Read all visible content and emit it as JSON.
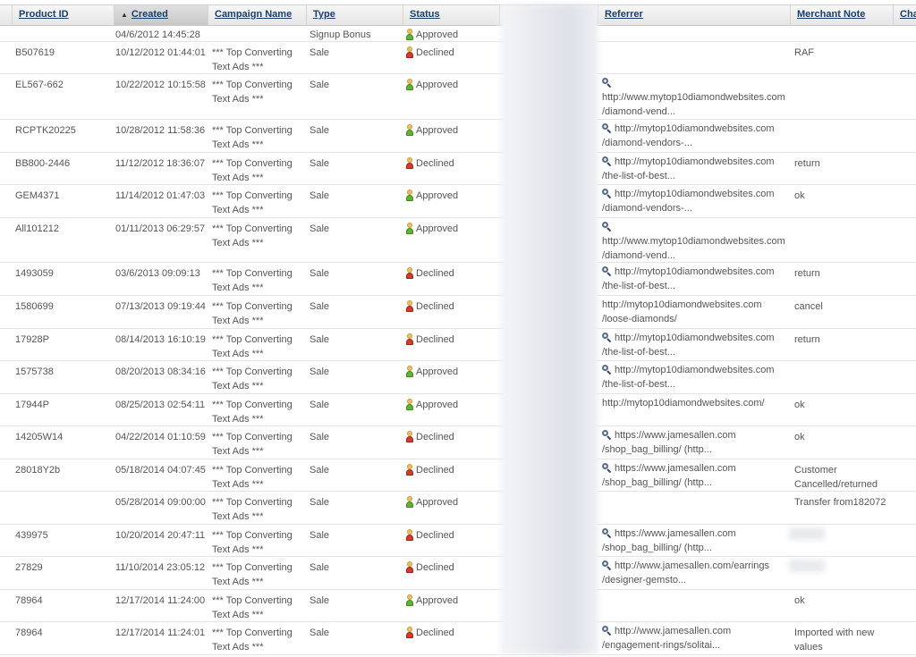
{
  "columns": [
    {
      "key": "product_id",
      "label": "Product ID"
    },
    {
      "key": "created",
      "label": "Created",
      "sorted": true
    },
    {
      "key": "campaign",
      "label": "Campaign Name"
    },
    {
      "key": "type",
      "label": "Type"
    },
    {
      "key": "status",
      "label": "Status"
    },
    {
      "key": "hidden",
      "label": ""
    },
    {
      "key": "referrer",
      "label": "Referrer"
    },
    {
      "key": "note",
      "label": "Merchant Note"
    },
    {
      "key": "extra",
      "label": "Cha"
    }
  ],
  "sort_icon": "sort-ascending-icon",
  "referrer_icon": "magnifier-icon",
  "status_colors": {
    "approved": "#5fb336",
    "declined": "#d33b2c"
  },
  "rows": [
    {
      "product_id": "",
      "created": "04/6/2012 14:45:28",
      "campaign": "",
      "type": "Signup Bonus",
      "status": "Approved",
      "referrer": "",
      "ref_icon": false,
      "note": ""
    },
    {
      "product_id": "B507619",
      "created": "10/12/2012 01:44:01",
      "campaign": "*** Top Converting Text Ads ***",
      "type": "Sale",
      "status": "Declined",
      "referrer": "",
      "ref_icon": false,
      "note": "RAF"
    },
    {
      "product_id": "EL567-662",
      "created": "10/22/2012 10:15:58",
      "campaign": "*** Top Converting Text Ads ***",
      "type": "Sale",
      "status": "Approved",
      "referrer": "http://www.mytop10diamondwebsites.com /diamond-vend...",
      "ref_icon": true,
      "ref_icon_block": true,
      "note": ""
    },
    {
      "product_id": "RCPTK20225",
      "created": "10/28/2012 11:58:36",
      "campaign": "*** Top Converting Text Ads ***",
      "type": "Sale",
      "status": "Approved",
      "referrer": "http://mytop10diamondwebsites.com /diamond-vendors-...",
      "ref_icon": true,
      "note": ""
    },
    {
      "product_id": "BB800-2446",
      "created": "11/12/2012 18:36:07",
      "campaign": "*** Top Converting Text Ads ***",
      "type": "Sale",
      "status": "Declined",
      "referrer": "http://mytop10diamondwebsites.com /the-list-of-best...",
      "ref_icon": true,
      "note": "return"
    },
    {
      "product_id": "GEM4371",
      "created": "11/14/2012 01:47:03",
      "campaign": "*** Top Converting Text Ads ***",
      "type": "Sale",
      "status": "Approved",
      "referrer": "http://mytop10diamondwebsites.com /diamond-vendors-...",
      "ref_icon": true,
      "note": "ok"
    },
    {
      "product_id": "All101212",
      "created": "01/11/2013 06:29:57",
      "campaign": "*** Top Converting Text Ads ***",
      "type": "Sale",
      "status": "Approved",
      "referrer": "http://www.mytop10diamondwebsites.com /diamond-vend...",
      "ref_icon": true,
      "ref_icon_block": true,
      "note": ""
    },
    {
      "product_id": "1493059",
      "created": "03/6/2013 09:09:13",
      "campaign": "*** Top Converting Text Ads ***",
      "type": "Sale",
      "status": "Declined",
      "referrer": "http://mytop10diamondwebsites.com /the-list-of-best...",
      "ref_icon": true,
      "note": "return"
    },
    {
      "product_id": "1580699",
      "created": "07/13/2013 09:19:44",
      "campaign": "*** Top Converting Text Ads ***",
      "type": "Sale",
      "status": "Declined",
      "referrer": "http://mytop10diamondwebsites.com /loose-diamonds/",
      "ref_icon": false,
      "note": "cancel"
    },
    {
      "product_id": "17928P",
      "created": "08/14/2013 16:10:19",
      "campaign": "*** Top Converting Text Ads ***",
      "type": "Sale",
      "status": "Declined",
      "referrer": "http://mytop10diamondwebsites.com /the-list-of-best...",
      "ref_icon": true,
      "note": "return"
    },
    {
      "product_id": "1575738",
      "created": "08/20/2013 08:34:16",
      "campaign": "*** Top Converting Text Ads ***",
      "type": "Sale",
      "status": "Approved",
      "referrer": "http://mytop10diamondwebsites.com /the-list-of-best...",
      "ref_icon": true,
      "note": ""
    },
    {
      "product_id": "17944P",
      "created": "08/25/2013 02:54:11",
      "campaign": "*** Top Converting Text Ads ***",
      "type": "Sale",
      "status": "Approved",
      "referrer": "http://mytop10diamondwebsites.com/",
      "ref_icon": false,
      "note": "ok"
    },
    {
      "product_id": "14205W14",
      "created": "04/22/2014 01:10:59",
      "campaign": "*** Top Converting Text Ads ***",
      "type": "Sale",
      "status": "Declined",
      "referrer": "https://www.jamesallen.com /shop_bag_billing/ (http...",
      "ref_icon": true,
      "note": "ok"
    },
    {
      "product_id": "28018Y2b",
      "created": "05/18/2014 04:07:45",
      "campaign": "*** Top Converting Text Ads ***",
      "type": "Sale",
      "status": "Declined",
      "referrer": "https://www.jamesallen.com /shop_bag_billing/ (http...",
      "ref_icon": true,
      "note": "Customer Cancelled/returned"
    },
    {
      "product_id": "",
      "created": "05/28/2014 09:00:00",
      "campaign": "*** Top Converting Text Ads ***",
      "type": "Sale",
      "status": "Approved",
      "referrer": "",
      "ref_icon": false,
      "note": "Transfer from182072"
    },
    {
      "product_id": "439975",
      "created": "10/20/2014 20:47:11",
      "campaign": "*** Top Converting Text Ads ***",
      "type": "Sale",
      "status": "Declined",
      "referrer": "https://www.jamesallen.com /shop_bag_billing/ (http...",
      "ref_icon": true,
      "note": ""
    },
    {
      "product_id": "27829",
      "created": "11/10/2014 23:05:12",
      "campaign": "*** Top Converting Text Ads ***",
      "type": "Sale",
      "status": "Declined",
      "referrer": "http://www.jamesallen.com/earrings /designer-gemsto...",
      "ref_icon": true,
      "note": ""
    },
    {
      "product_id": "78964",
      "created": "12/17/2014 11:24:00",
      "campaign": "*** Top Converting Text Ads ***",
      "type": "Sale",
      "status": "Approved",
      "referrer": "",
      "ref_icon": false,
      "note": "ok"
    },
    {
      "product_id": "78964",
      "created": "12/17/2014 11:24:01",
      "campaign": "*** Top Converting Text Ads ***",
      "type": "Sale",
      "status": "Declined",
      "referrer": "http://www.jamesallen.com /engagement-rings/solitai...",
      "ref_icon": true,
      "note": "Imported with new values"
    }
  ]
}
